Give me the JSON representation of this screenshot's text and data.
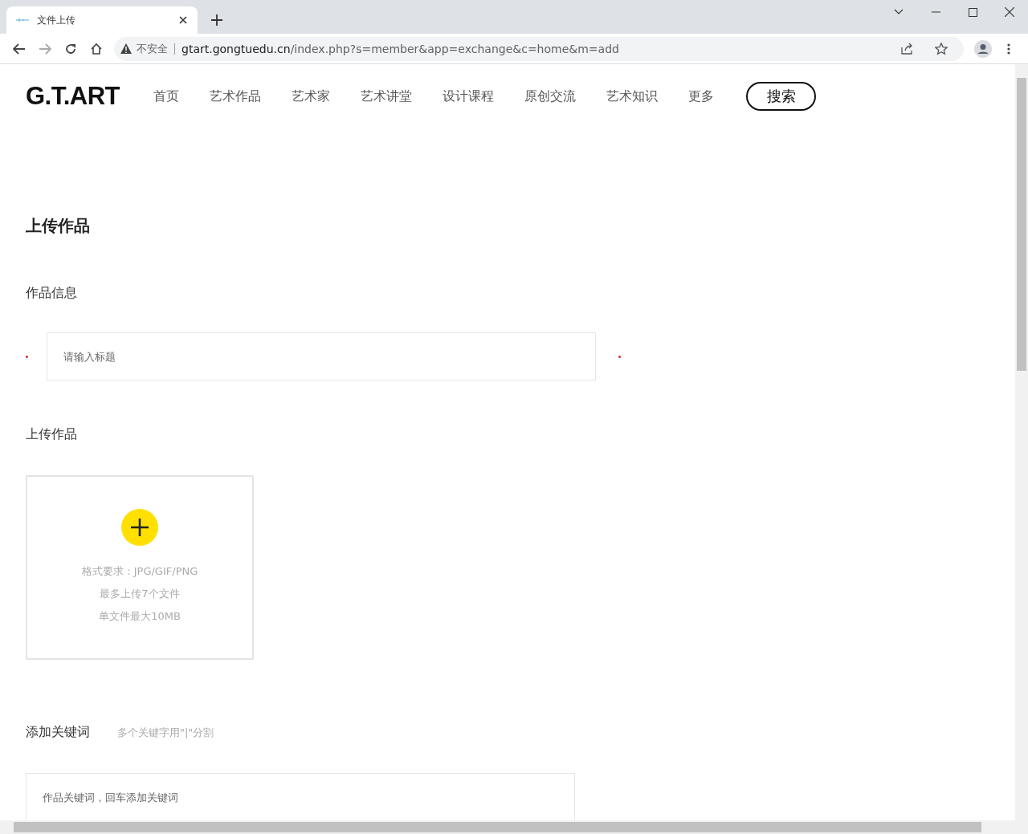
{
  "browser": {
    "tab_title": "文件上传",
    "security_label": "不安全",
    "url_host": "gtart.gongtuedu.cn",
    "url_path": "/index.php?s=member&app=exchange&c=home&m=add"
  },
  "site": {
    "logo": "G.T.ART",
    "nav": [
      "首页",
      "艺术作品",
      "艺术家",
      "艺术讲堂",
      "设计课程",
      "原创交流",
      "艺术知识",
      "更多"
    ],
    "search_button": "搜索"
  },
  "page_title": "上传作品",
  "info_section": {
    "label": "作品信息",
    "title_field": {
      "placeholder": "请输入标题",
      "required": true
    }
  },
  "upload_section": {
    "label": "上传作品",
    "hints": [
      "格式要求：JPG/GIF/PNG",
      "最多上传7个文件",
      "单文件最大10MB"
    ]
  },
  "keyword_section": {
    "label": "添加关键词",
    "hint": "多个关键字用\"|\"分割",
    "field": {
      "placeholder": "作品关键词，回车添加关键词"
    }
  }
}
